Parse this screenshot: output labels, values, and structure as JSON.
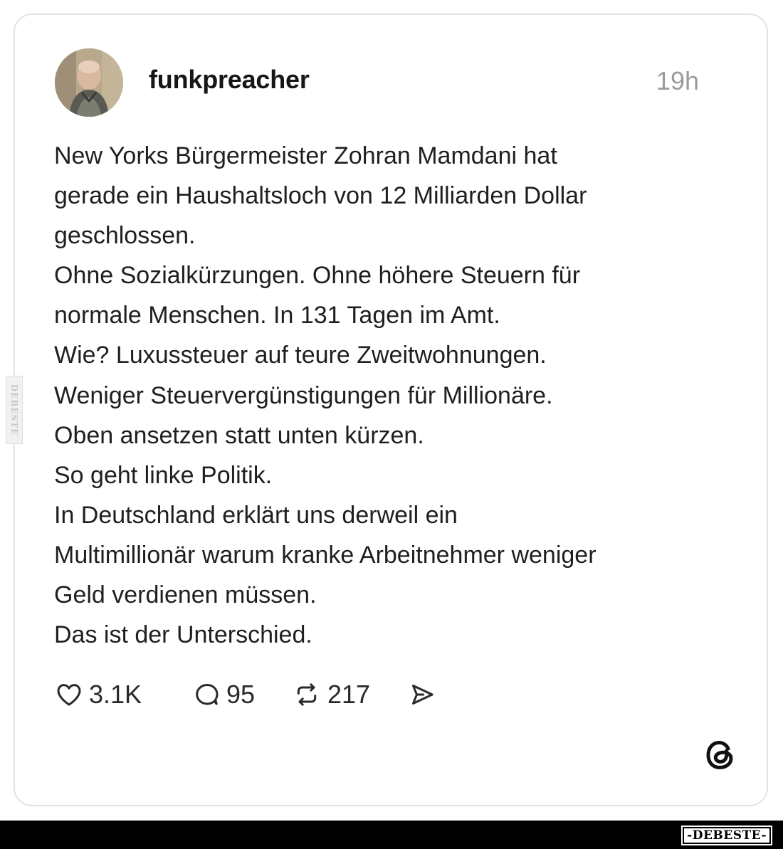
{
  "post": {
    "username": "funkpreacher",
    "timestamp": "19h",
    "lines": [
      "New Yorks Bürgermeister Zohran Mamdani hat",
      "gerade ein Haushaltsloch von 12 Milliarden Dollar",
      "geschlossen.",
      "Ohne Sozialkürzungen. Ohne höhere Steuern für",
      "normale Menschen. In 131 Tagen im Amt.",
      "Wie? Luxussteuer auf teure Zweitwohnungen.",
      "Weniger Steuervergünstigungen für Millionäre.",
      "Oben ansetzen statt unten kürzen.",
      "So geht linke Politik.",
      "In Deutschland erklärt uns derweil ein",
      "Multimillionär warum kranke Arbeitnehmer weniger",
      "Geld verdienen müssen.",
      "Das ist der Unterschied."
    ],
    "actions": {
      "likes": "3.1K",
      "comments": "95",
      "reposts": "217"
    },
    "icons": [
      "avatar",
      "heart-icon",
      "comment-icon",
      "repost-icon",
      "share-icon",
      "threads-logo-icon"
    ]
  },
  "watermark": {
    "side_text": "DEBESTE",
    "bottom_text": "-DEBESTE-"
  },
  "colors": {
    "text": "#1f1f1f",
    "muted": "#9b9b9b",
    "card_border": "#e2e2e2",
    "bottom_bar": "#000000"
  }
}
